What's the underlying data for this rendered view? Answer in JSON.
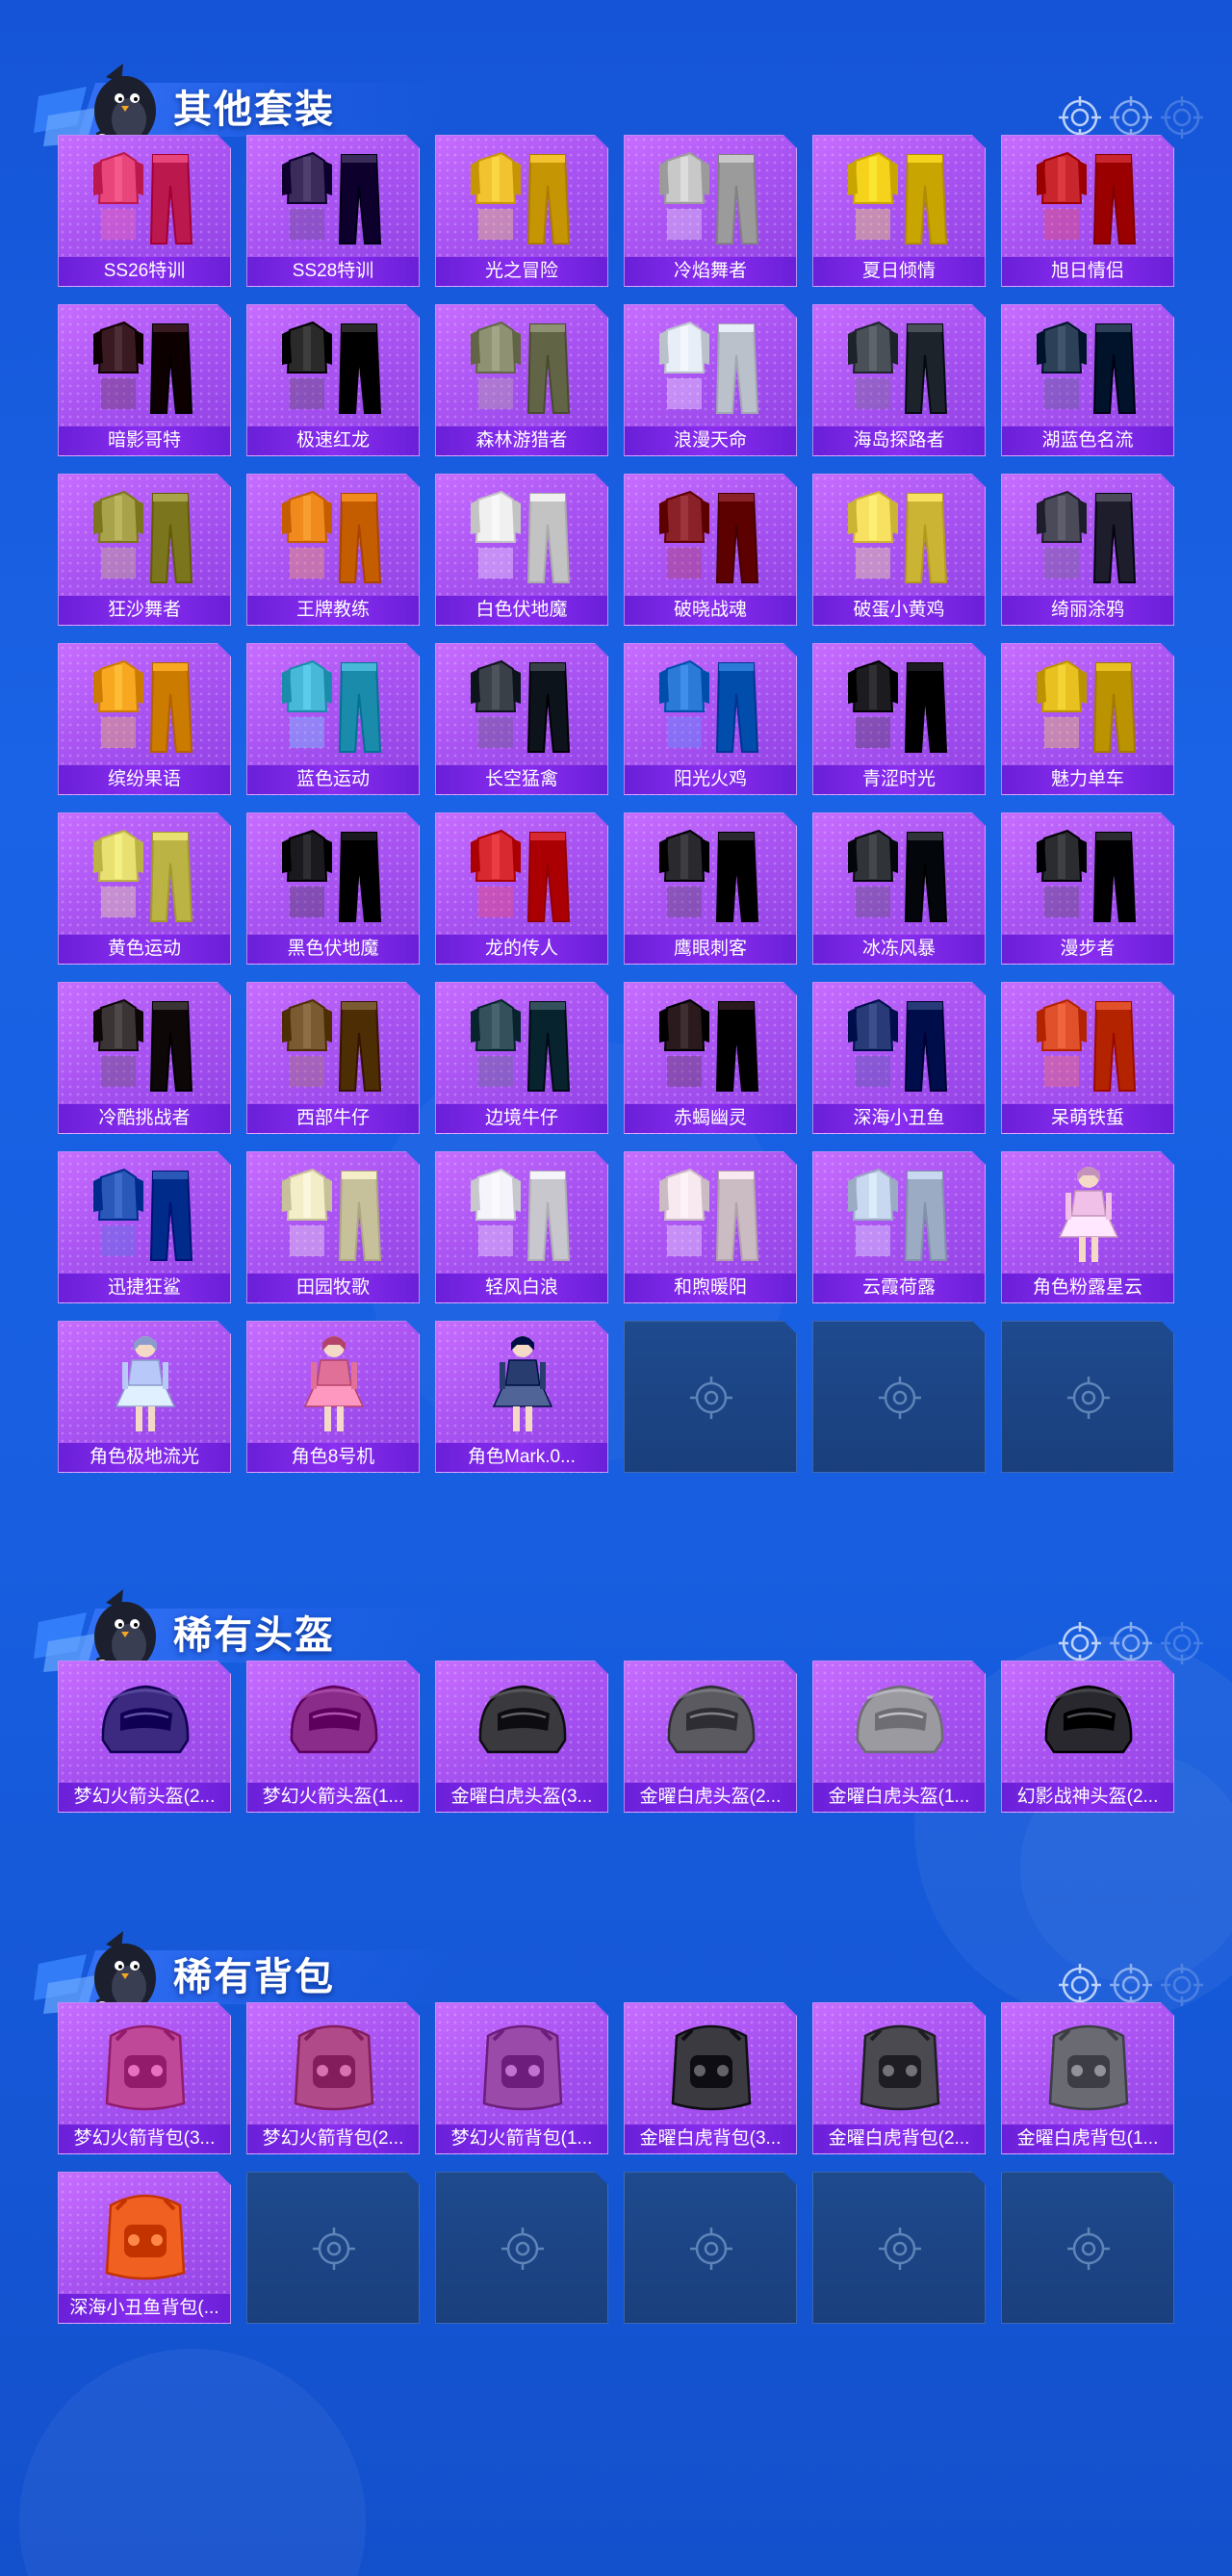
{
  "theme": {
    "background": "#1a63e6",
    "card_purple": "#a953f2",
    "label_purple": "#7a25e4",
    "empty_slot": "#1e4a8e"
  },
  "sections": [
    {
      "title": "其他套装",
      "icon": "penguin-mascot-icon",
      "items": [
        {
          "name": "SS26特训",
          "kind": "suit",
          "color": "#e8457a"
        },
        {
          "name": "SS28特训",
          "kind": "suit",
          "color": "#3a2b5a"
        },
        {
          "name": "光之冒险",
          "kind": "suit",
          "color": "#f2c230"
        },
        {
          "name": "冷焰舞者",
          "kind": "suit",
          "color": "#c8c8c8"
        },
        {
          "name": "夏日倾情",
          "kind": "suit",
          "color": "#f5d21c"
        },
        {
          "name": "旭日情侣",
          "kind": "suit",
          "color": "#c8262c"
        },
        {
          "name": "暗影哥特",
          "kind": "suit",
          "color": "#3a1a22"
        },
        {
          "name": "极速红龙",
          "kind": "suit",
          "color": "#2a2a2a"
        },
        {
          "name": "森林游猎者",
          "kind": "suit",
          "color": "#8e9272"
        },
        {
          "name": "浪漫天命",
          "kind": "suit",
          "color": "#e8eef8"
        },
        {
          "name": "海岛探路者",
          "kind": "suit",
          "color": "#4a5058"
        },
        {
          "name": "湖蓝色名流",
          "kind": "suit",
          "color": "#2c4058"
        },
        {
          "name": "狂沙舞者",
          "kind": "suit",
          "color": "#a8a24a"
        },
        {
          "name": "王牌教练",
          "kind": "suit",
          "color": "#f08a1c"
        },
        {
          "name": "白色伏地魔",
          "kind": "suit",
          "color": "#f0f0f0"
        },
        {
          "name": "破晓战魂",
          "kind": "suit",
          "color": "#8a2028"
        },
        {
          "name": "破蛋小黄鸡",
          "kind": "suit",
          "color": "#f8e060"
        },
        {
          "name": "绮丽涂鸦",
          "kind": "suit",
          "color": "#4a4a58"
        },
        {
          "name": "缤纷果语",
          "kind": "suit",
          "color": "#f8a820"
        },
        {
          "name": "蓝色运动",
          "kind": "suit",
          "color": "#48b8d8"
        },
        {
          "name": "长空猛禽",
          "kind": "suit",
          "color": "#3a4048"
        },
        {
          "name": "阳光火鸡",
          "kind": "suit",
          "color": "#2c7ad8"
        },
        {
          "name": "青涩时光",
          "kind": "suit",
          "color": "#1c1c20"
        },
        {
          "name": "魅力单车",
          "kind": "suit",
          "color": "#e8c020"
        },
        {
          "name": "黄色运动",
          "kind": "suit",
          "color": "#e8e070"
        },
        {
          "name": "黑色伏地魔",
          "kind": "suit",
          "color": "#1a1a1e"
        },
        {
          "name": "龙的传人",
          "kind": "suit",
          "color": "#d82830"
        },
        {
          "name": "鹰眼刺客",
          "kind": "suit",
          "color": "#2a2a2e"
        },
        {
          "name": "冰冻风暴",
          "kind": "suit",
          "color": "#303438"
        },
        {
          "name": "漫步者",
          "kind": "suit",
          "color": "#2a2c30"
        },
        {
          "name": "冷酷挑战者",
          "kind": "suit",
          "color": "#3a3434"
        },
        {
          "name": "西部牛仔",
          "kind": "suit",
          "color": "#7a5a30"
        },
        {
          "name": "边境牛仔",
          "kind": "suit",
          "color": "#34505a"
        },
        {
          "name": "赤蝎幽灵",
          "kind": "suit",
          "color": "#2a1a1e"
        },
        {
          "name": "深海小丑鱼",
          "kind": "suit",
          "color": "#283a78"
        },
        {
          "name": "呆萌铁蜇",
          "kind": "suit",
          "color": "#e0502a"
        },
        {
          "name": "迅捷狂鲨",
          "kind": "suit",
          "color": "#2a58b8"
        },
        {
          "name": "田园牧歌",
          "kind": "suit",
          "color": "#f4eec8"
        },
        {
          "name": "轻风白浪",
          "kind": "suit",
          "color": "#f4f4fa"
        },
        {
          "name": "和煦暖阳",
          "kind": "suit",
          "color": "#f8e8f0"
        },
        {
          "name": "云霞荷露",
          "kind": "suit",
          "color": "#c8d8f0"
        },
        {
          "name": "角色粉露星云",
          "kind": "char",
          "color": "#f0c0e8"
        },
        {
          "name": "角色极地流光",
          "kind": "char",
          "color": "#b8c8f8"
        },
        {
          "name": "角色8号机",
          "kind": "char",
          "color": "#e07098"
        },
        {
          "name": "角色Mark.0...",
          "kind": "char",
          "color": "#283c70"
        },
        {
          "name": "",
          "kind": "empty"
        },
        {
          "name": "",
          "kind": "empty"
        },
        {
          "name": "",
          "kind": "empty"
        }
      ]
    },
    {
      "title": "稀有头盔",
      "icon": "penguin-mascot-icon",
      "items": [
        {
          "name": "梦幻火箭头盔(2...",
          "kind": "helmet",
          "color": "#3c2a80"
        },
        {
          "name": "梦幻火箭头盔(1...",
          "kind": "helmet",
          "color": "#8a2c8a"
        },
        {
          "name": "金曜白虎头盔(3...",
          "kind": "helmet",
          "color": "#3a3a3e"
        },
        {
          "name": "金曜白虎头盔(2...",
          "kind": "helmet",
          "color": "#5a5a60"
        },
        {
          "name": "金曜白虎头盔(1...",
          "kind": "helmet",
          "color": "#9a9aa0"
        },
        {
          "name": "幻影战神头盔(2...",
          "kind": "helmet",
          "color": "#28282e"
        }
      ]
    },
    {
      "title": "稀有背包",
      "icon": "penguin-mascot-icon",
      "items": [
        {
          "name": "梦幻火箭背包(3...",
          "kind": "backpack",
          "color": "#c04898"
        },
        {
          "name": "梦幻火箭背包(2...",
          "kind": "backpack",
          "color": "#b04a88"
        },
        {
          "name": "梦幻火箭背包(1...",
          "kind": "backpack",
          "color": "#9a4aa8"
        },
        {
          "name": "金曜白虎背包(3...",
          "kind": "backpack",
          "color": "#3a3a40"
        },
        {
          "name": "金曜白虎背包(2...",
          "kind": "backpack",
          "color": "#4a4a50"
        },
        {
          "name": "金曜白虎背包(1...",
          "kind": "backpack",
          "color": "#6a6a72"
        },
        {
          "name": "深海小丑鱼背包(...",
          "kind": "backpack",
          "color": "#f06020"
        },
        {
          "name": "",
          "kind": "empty"
        },
        {
          "name": "",
          "kind": "empty"
        },
        {
          "name": "",
          "kind": "empty"
        },
        {
          "name": "",
          "kind": "empty"
        },
        {
          "name": "",
          "kind": "empty"
        }
      ]
    }
  ]
}
